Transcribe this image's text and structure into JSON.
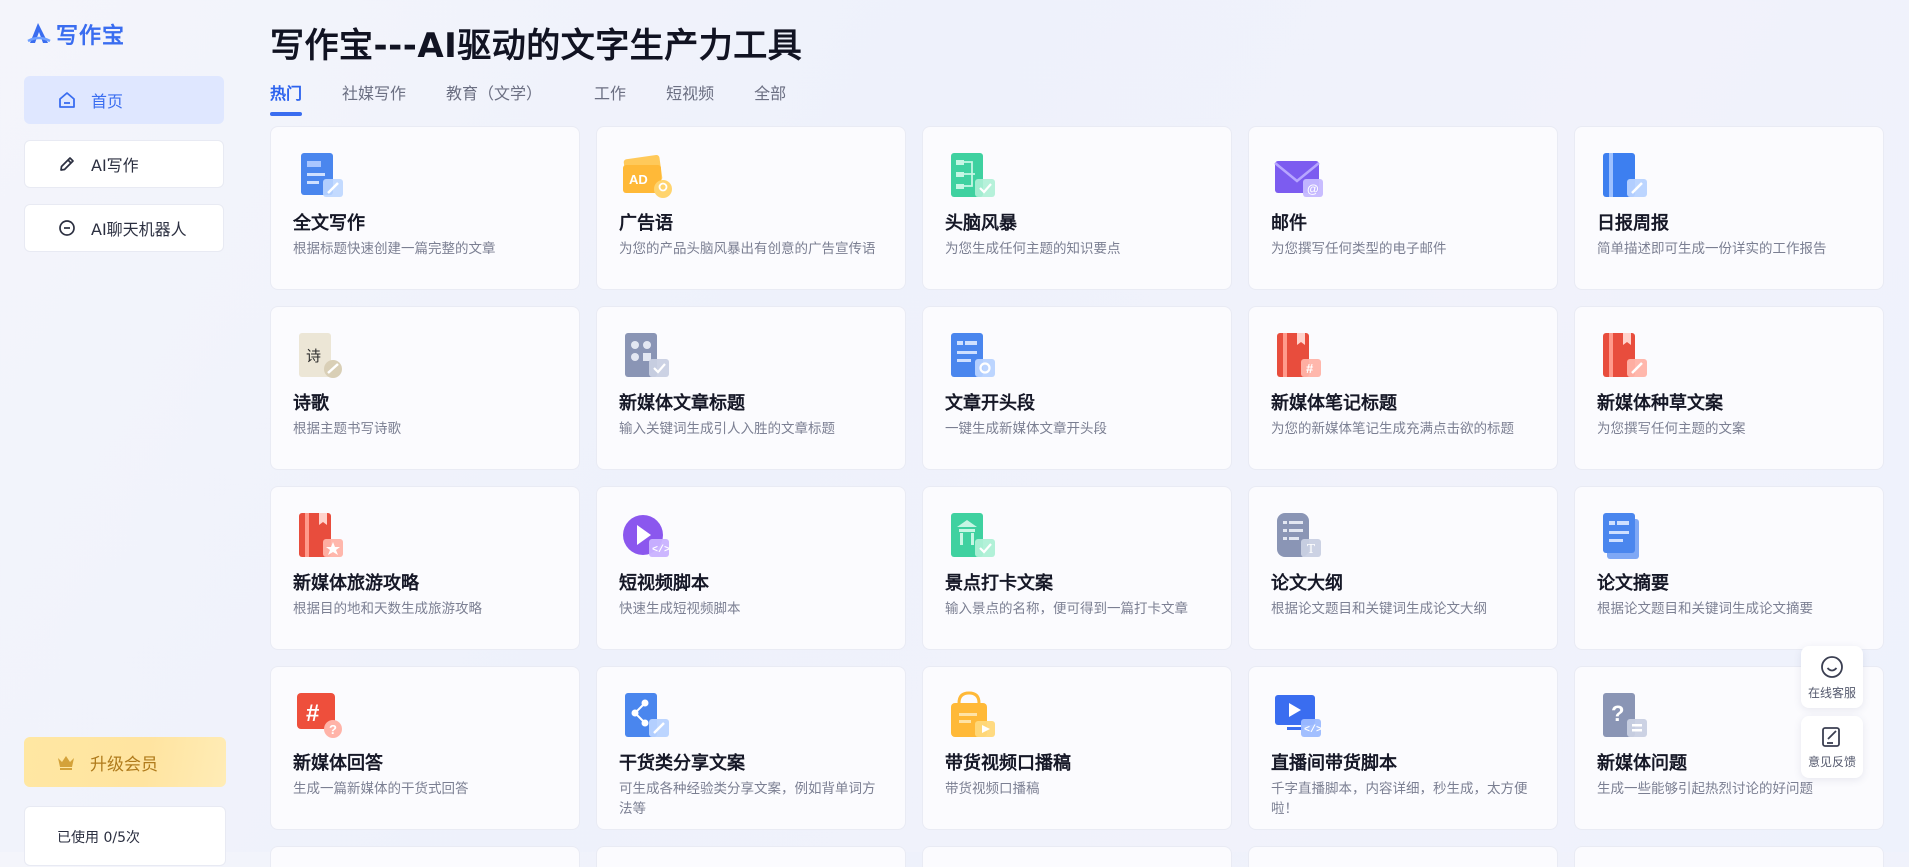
{
  "app": {
    "name": "写作宝"
  },
  "sidebar": {
    "items": [
      {
        "label": "首页",
        "icon": "home-icon",
        "active": true
      },
      {
        "label": "AI写作",
        "icon": "pen-icon",
        "active": false
      },
      {
        "label": "AI聊天机器人",
        "icon": "chat-bubble-icon",
        "active": false
      }
    ],
    "upgrade_label": "升级会员",
    "usage_text": "已使用 0/5次"
  },
  "main": {
    "title": "写作宝---AI驱动的文字生产力工具",
    "tabs": [
      {
        "label": "热门",
        "active": true
      },
      {
        "label": "社媒写作",
        "active": false
      },
      {
        "label": "教育（文学）",
        "active": false
      },
      {
        "label": "工作",
        "active": false
      },
      {
        "label": "短视频",
        "active": false
      },
      {
        "label": "全部",
        "active": false
      }
    ],
    "cards": [
      {
        "title": "全文写作",
        "desc": "根据标题快速创建一篇完整的文章",
        "icon": "document-edit-icon"
      },
      {
        "title": "广告语",
        "desc": "为您的产品头脑风暴出有创意的广告宣传语",
        "icon": "ad-card-icon"
      },
      {
        "title": "头脑风暴",
        "desc": "为您生成任何主题的知识要点",
        "icon": "mindmap-icon"
      },
      {
        "title": "邮件",
        "desc": "为您撰写任何类型的电子邮件",
        "icon": "envelope-icon"
      },
      {
        "title": "日报周报",
        "desc": "简单描述即可生成一份详实的工作报告",
        "icon": "report-book-icon"
      },
      {
        "title": "诗歌",
        "desc": "根据主题书写诗歌",
        "icon": "poem-scroll-icon"
      },
      {
        "title": "新媒体文章标题",
        "desc": "输入关键词生成引人入胜的文章标题",
        "icon": "article-title-icon"
      },
      {
        "title": "文章开头段",
        "desc": "一键生成新媒体文章开头段",
        "icon": "document-gear-icon"
      },
      {
        "title": "新媒体笔记标题",
        "desc": "为您的新媒体笔记生成充满点击欲的标题",
        "icon": "notebook-hash-icon"
      },
      {
        "title": "新媒体种草文案",
        "desc": "为您撰写任何主题的文案",
        "icon": "notebook-pen-icon"
      },
      {
        "title": "新媒体旅游攻略",
        "desc": "根据目的地和天数生成旅游攻略",
        "icon": "notebook-star-icon"
      },
      {
        "title": "短视频脚本",
        "desc": "快速生成短视频脚本",
        "icon": "video-play-icon"
      },
      {
        "title": "景点打卡文案",
        "desc": "输入景点的名称，便可得到一篇打卡文章",
        "icon": "landmark-check-icon"
      },
      {
        "title": "论文大纲",
        "desc": "根据论文题目和关键词生成论文大纲",
        "icon": "outline-list-icon"
      },
      {
        "title": "论文摘要",
        "desc": "根据论文题目和关键词生成论文摘要",
        "icon": "abstract-doc-icon"
      },
      {
        "title": "新媒体回答",
        "desc": "生成一篇新媒体的干货式回答",
        "icon": "hashtag-question-icon"
      },
      {
        "title": "干货类分享文案",
        "desc": "可生成各种经验类分享文案，例如背单词方法等",
        "icon": "share-doc-icon"
      },
      {
        "title": "带货视频口播稿",
        "desc": "带货视频口播稿",
        "icon": "shopping-bag-icon"
      },
      {
        "title": "直播间带货脚本",
        "desc": "千字直播脚本，内容详细，秒生成，太方便啦！",
        "icon": "live-screen-icon"
      },
      {
        "title": "新媒体问题",
        "desc": "生成一些能够引起热烈讨论的好问题",
        "icon": "question-doc-icon"
      }
    ]
  },
  "floating": {
    "service_label": "在线客服",
    "feedback_label": "意见反馈"
  },
  "colors": {
    "accent": "#3a6df0",
    "upgrade_text": "#b07b1c"
  }
}
